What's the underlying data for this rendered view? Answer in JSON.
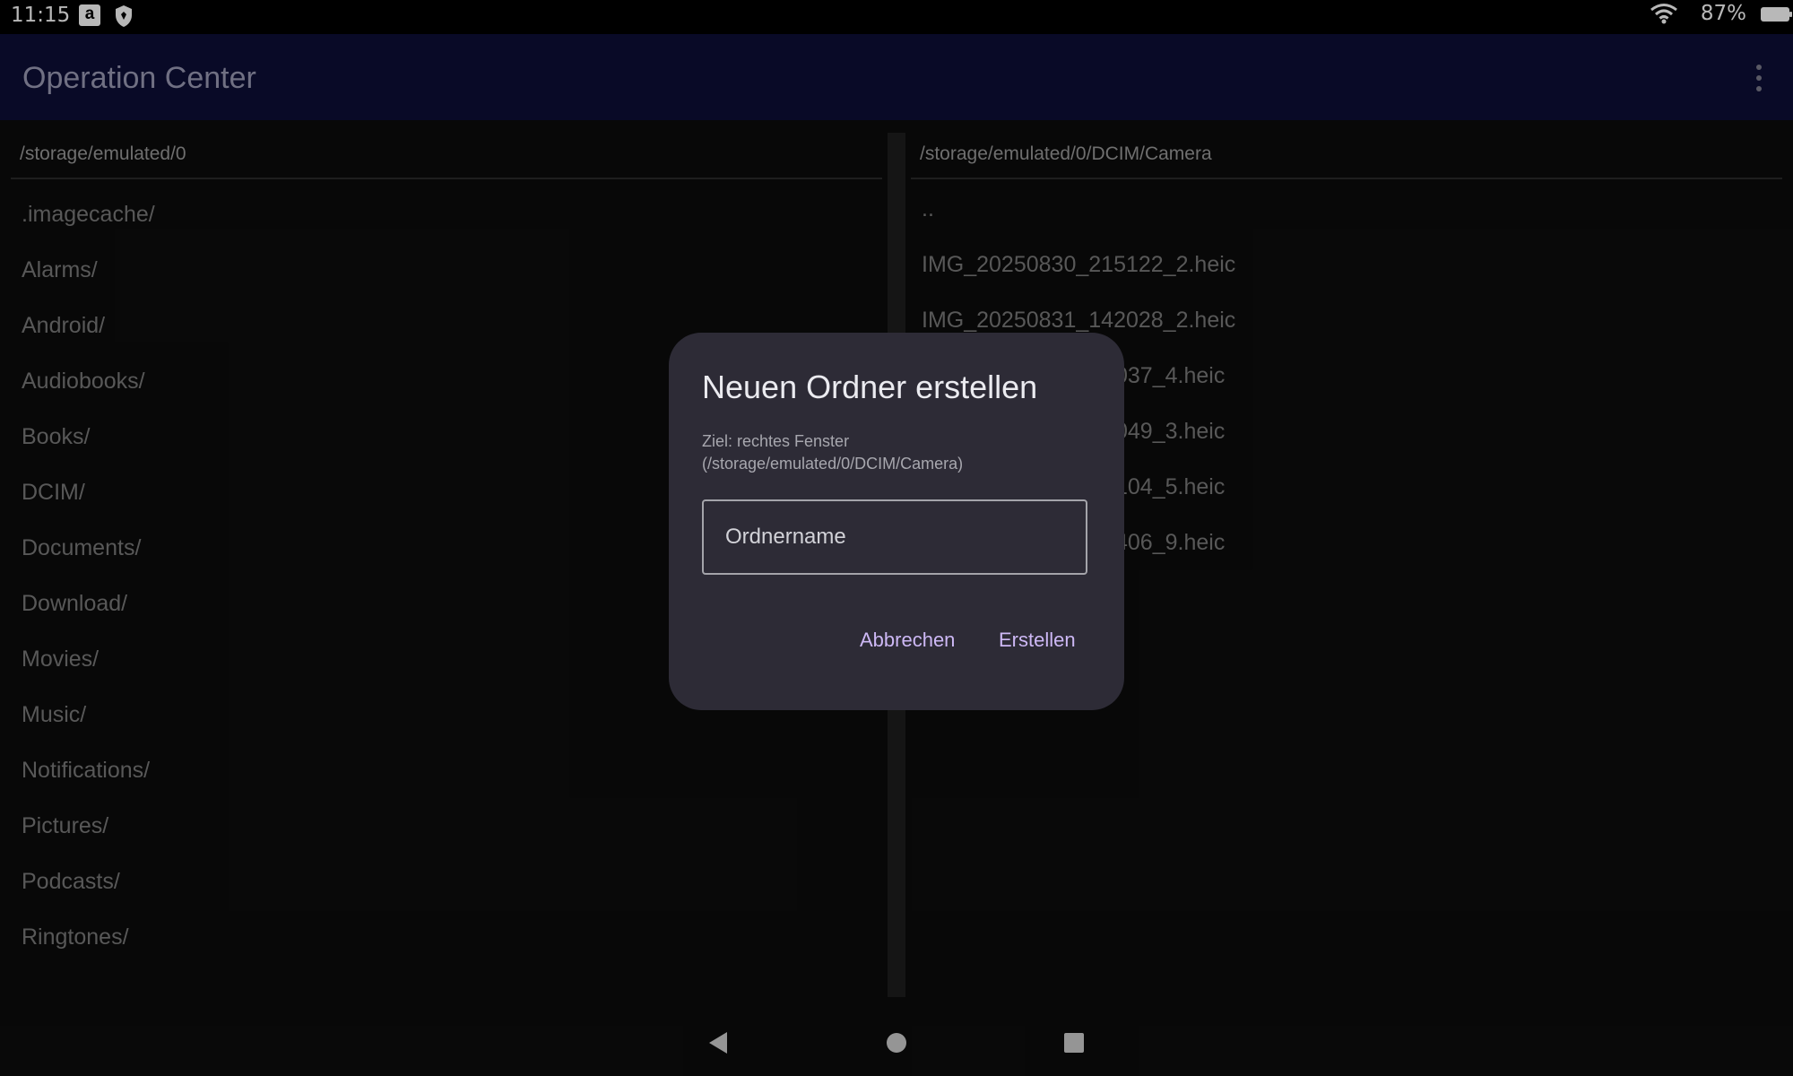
{
  "status_bar": {
    "time": "11:15",
    "battery": "87%",
    "icons": [
      "amazon-icon",
      "shield-icon",
      "wifi-icon",
      "battery-icon"
    ]
  },
  "app_bar": {
    "title": "Operation Center",
    "menu_icon": "overflow-menu-icon"
  },
  "left_pane": {
    "path": "/storage/emulated/0",
    "items": [
      ".imagecache/",
      "Alarms/",
      "Android/",
      "Audiobooks/",
      "Books/",
      "DCIM/",
      "Documents/",
      "Download/",
      "Movies/",
      "Music/",
      "Notifications/",
      "Pictures/",
      "Podcasts/",
      "Ringtones/"
    ]
  },
  "right_pane": {
    "path": "/storage/emulated/0/DCIM/Camera",
    "items": [
      "..",
      "IMG_20250830_215122_2.heic",
      "IMG_20250831_142028_2.heic",
      "037_4.heic",
      "049_3.heic",
      "104_5.heic",
      "406_9.heic"
    ]
  },
  "dialog": {
    "title": "Neuen Ordner erstellen",
    "message_line1": "Ziel: rechtes Fenster",
    "message_line2": "(/storage/emulated/0/DCIM/Camera)",
    "input_placeholder": "Ordnername",
    "input_value": "",
    "cancel_label": "Abbrechen",
    "create_label": "Erstellen"
  },
  "colors": {
    "app_bar": "#0d0e36",
    "dialog_bg": "#2d2b36",
    "accent": "#cdb8f5"
  }
}
